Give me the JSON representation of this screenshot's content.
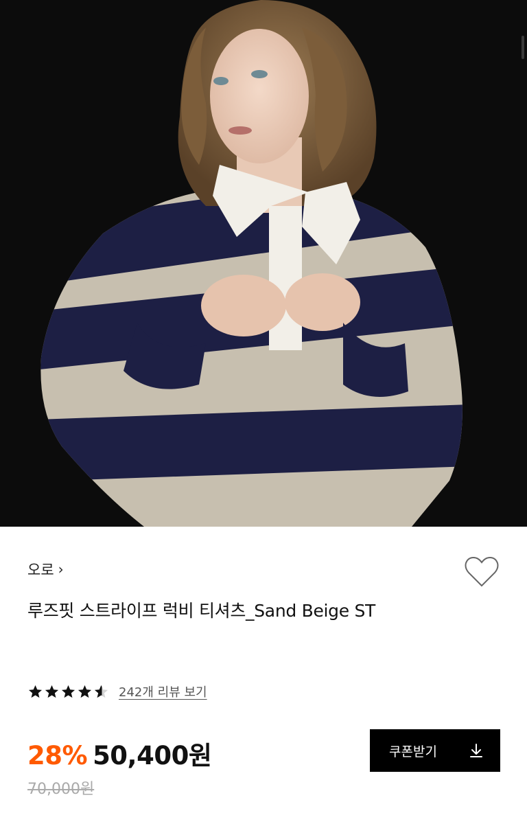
{
  "product": {
    "brand": "오로",
    "title": "루즈핏 스트라이프 럭비 티셔츠_Sand Beige ST",
    "rating": 4.5,
    "review_link": "242개 리뷰 보기",
    "discount": "28%",
    "sale_price": "50,400원",
    "original_price": "70,000원",
    "coupon_button": "쿠폰받기"
  },
  "icons": {
    "brand_chevron": "chevron-right-icon",
    "wishlist": "heart-icon",
    "download": "download-icon",
    "star": "star-icon"
  },
  "colors": {
    "discount": "#ff5a00",
    "button_bg": "#000000",
    "stripe_navy": "#1d1f44",
    "stripe_sand": "#c7bfaf"
  }
}
